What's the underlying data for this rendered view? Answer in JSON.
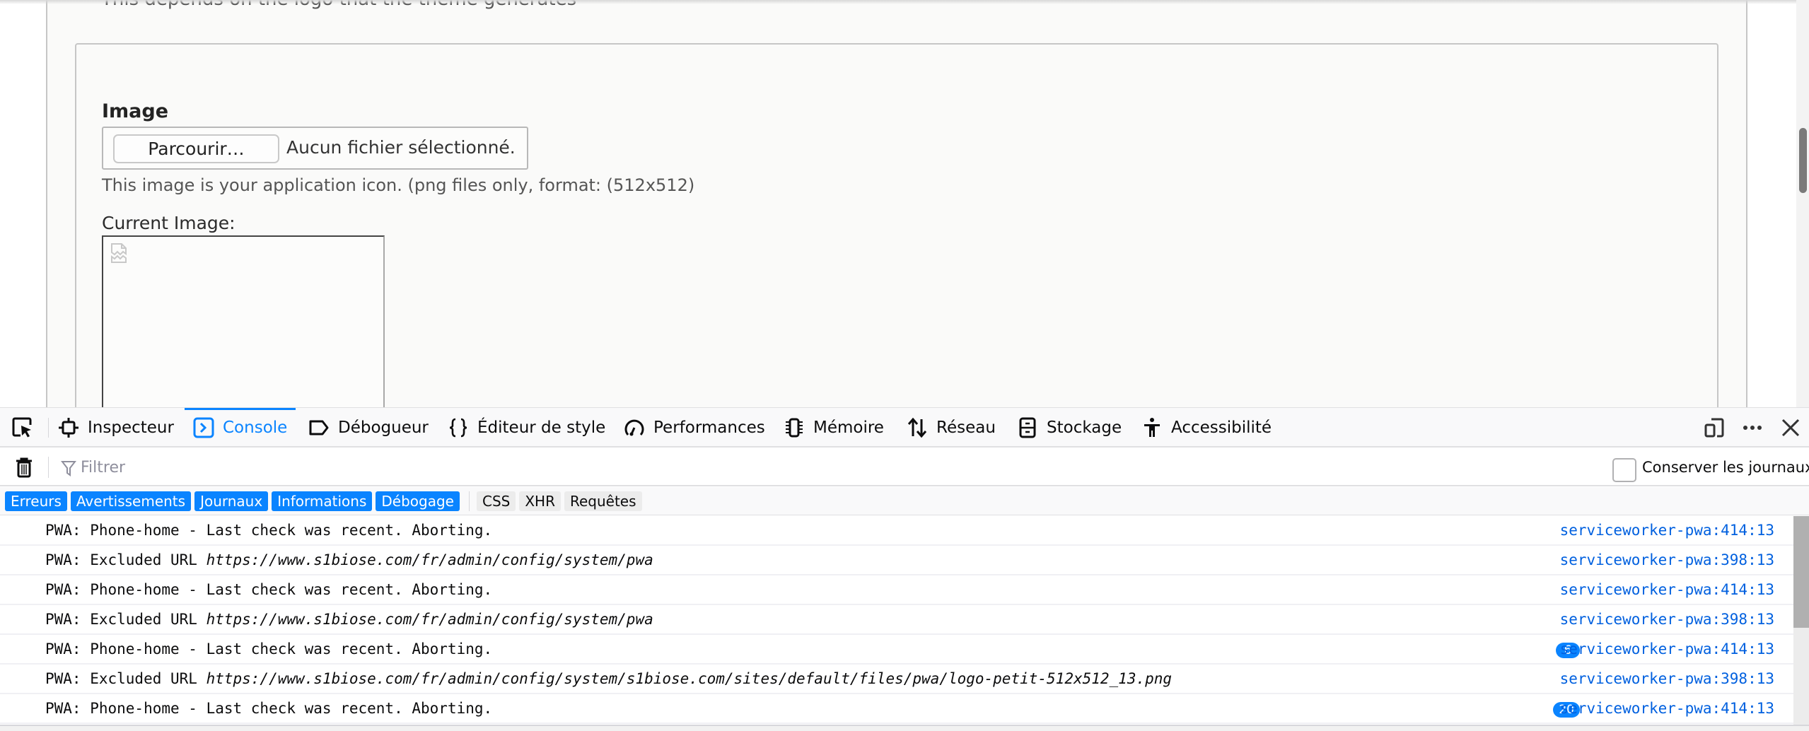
{
  "page": {
    "top_description": "This depends on the logo that the theme generates",
    "image_field": {
      "label": "Image",
      "browse_button": "Parcourir…",
      "no_file_text": "Aucun fichier sélectionné.",
      "description": "This image is your application icon. (png files only, format: (512x512)",
      "current_image_label": "Current Image:"
    }
  },
  "devtools": {
    "tabs": [
      {
        "label": "Inspecteur",
        "icon": "inspector-icon",
        "active": false
      },
      {
        "label": "Console",
        "icon": "console-icon",
        "active": true
      },
      {
        "label": "Débogueur",
        "icon": "debugger-icon",
        "active": false
      },
      {
        "label": "Éditeur de style",
        "icon": "style-editor-icon",
        "active": false
      },
      {
        "label": "Performances",
        "icon": "performance-icon",
        "active": false
      },
      {
        "label": "Mémoire",
        "icon": "memory-icon",
        "active": false
      },
      {
        "label": "Réseau",
        "icon": "network-icon",
        "active": false
      },
      {
        "label": "Stockage",
        "icon": "storage-icon",
        "active": false
      },
      {
        "label": "Accessibilité",
        "icon": "accessibility-icon",
        "active": false
      }
    ],
    "filter": {
      "placeholder": "Filtrer",
      "value": "",
      "persist_logs_label": "Conserver les journaux",
      "persist_logs_checked": false
    },
    "levels": [
      {
        "label": "Erreurs",
        "enabled": true
      },
      {
        "label": "Avertissements",
        "enabled": true
      },
      {
        "label": "Journaux",
        "enabled": true
      },
      {
        "label": "Informations",
        "enabled": true
      },
      {
        "label": "Débogage",
        "enabled": true
      }
    ],
    "request_filters": [
      {
        "label": "CSS",
        "enabled": false
      },
      {
        "label": "XHR",
        "enabled": false
      },
      {
        "label": "Requêtes",
        "enabled": false
      }
    ],
    "messages": [
      {
        "text": "PWA: Phone-home - Last check was recent. Aborting.",
        "url": "",
        "source": "serviceworker-pwa:414:13",
        "count": ""
      },
      {
        "text": "PWA: Excluded URL ",
        "url": "https://www.s1biose.com/fr/admin/config/system/pwa",
        "source": "serviceworker-pwa:398:13",
        "count": ""
      },
      {
        "text": "PWA: Phone-home - Last check was recent. Aborting.",
        "url": "",
        "source": "serviceworker-pwa:414:13",
        "count": ""
      },
      {
        "text": "PWA: Excluded URL ",
        "url": "https://www.s1biose.com/fr/admin/config/system/pwa",
        "source": "serviceworker-pwa:398:13",
        "count": ""
      },
      {
        "text": "PWA: Phone-home - Last check was recent. Aborting.",
        "url": "",
        "source": "serviceworker-pwa:414:13",
        "count": "6"
      },
      {
        "text": "PWA: Excluded URL ",
        "url": "https://www.s1biose.com/fr/admin/config/system/s1biose.com/sites/default/files/pwa/logo-petit-512x512_13.png",
        "source": "serviceworker-pwa:398:13",
        "count": ""
      },
      {
        "text": "PWA: Phone-home - Last check was recent. Aborting.",
        "url": "",
        "source": "serviceworker-pwa:414:13",
        "count": "20"
      }
    ]
  },
  "colors": {
    "accent": "#0a84ff",
    "source_link": "#0060df"
  }
}
